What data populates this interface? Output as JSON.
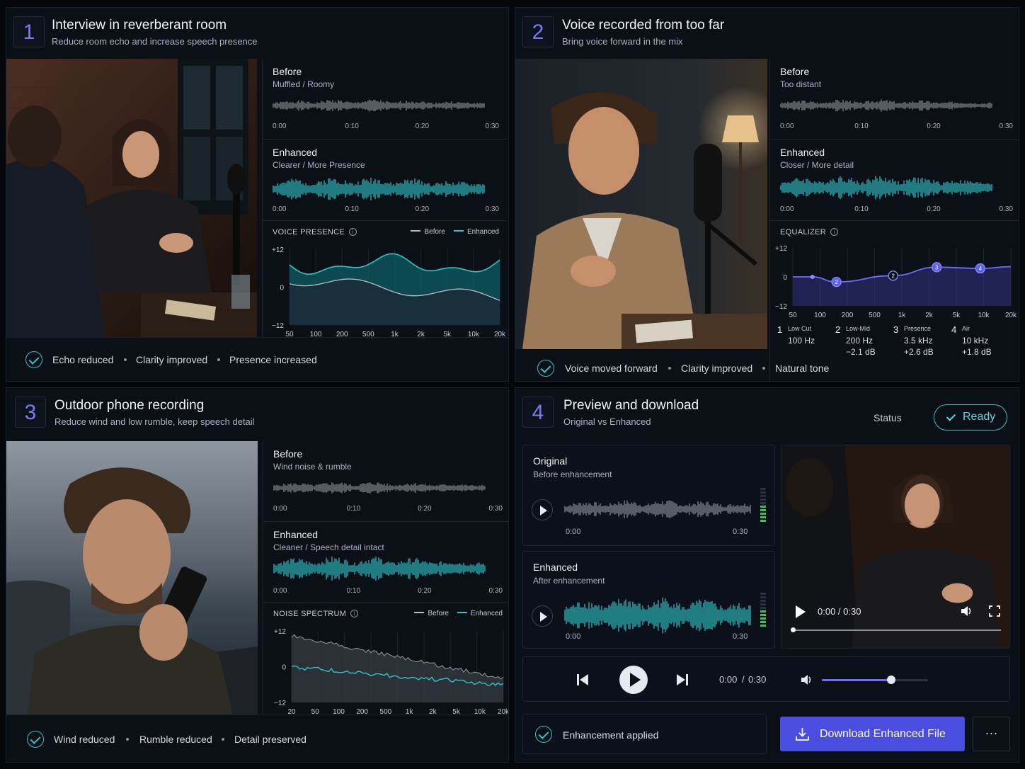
{
  "panels": [
    {
      "num": "1",
      "title": "Interview in reverberant room",
      "subtitle": "Reduce room echo and increase speech presence",
      "before": {
        "title": "Before",
        "subtitle": "Muffled / Roomy"
      },
      "enhanced": {
        "title": "Enhanced",
        "subtitle": "Clearer / More Presence"
      },
      "times": [
        "0:00",
        "0:10",
        "0:20",
        "0:30"
      ],
      "chart_label": "VOICE PRESENCE",
      "legend_before": "Before",
      "legend_enhanced": "Enhanced",
      "yticks": [
        "+12",
        "0",
        "−12"
      ],
      "xticks": [
        "50",
        "100",
        "200",
        "500",
        "1k",
        "2k",
        "5k",
        "10k",
        "20k"
      ],
      "footer": [
        "Echo reduced",
        "Clarity improved",
        "Presence increased"
      ]
    },
    {
      "num": "2",
      "title": "Voice recorded from too far",
      "subtitle": "Bring voice forward in the mix",
      "before": {
        "title": "Before",
        "subtitle": "Too distant"
      },
      "enhanced": {
        "title": "Enhanced",
        "subtitle": "Closer / More detail"
      },
      "times": [
        "0:00",
        "0:10",
        "0:20",
        "0:30"
      ],
      "chart_label": "EQUALIZER",
      "yticks": [
        "+12",
        "0",
        "−12"
      ],
      "xticks": [
        "50",
        "100",
        "200",
        "500",
        "1k",
        "2k",
        "5k",
        "10k",
        "20k"
      ],
      "bands": [
        {
          "n": "1",
          "name": "Low Cut",
          "freq": "100 Hz",
          "gain": ""
        },
        {
          "n": "2",
          "name": "Low-Mid",
          "freq": "200 Hz",
          "gain": "−2.1 dB"
        },
        {
          "n": "3",
          "name": "Presence",
          "freq": "3.5 kHz",
          "gain": "+2.6 dB"
        },
        {
          "n": "4",
          "name": "Air",
          "freq": "10 kHz",
          "gain": "+1.8 dB"
        }
      ],
      "footer": [
        "Voice moved forward",
        "Clarity improved",
        "Natural tone"
      ]
    },
    {
      "num": "3",
      "title": "Outdoor phone recording",
      "subtitle": "Reduce wind and low rumble, keep speech detail",
      "before": {
        "title": "Before",
        "subtitle": "Wind noise & rumble"
      },
      "enhanced": {
        "title": "Enhanced",
        "subtitle": "Cleaner / Speech detail intact"
      },
      "times": [
        "0:00",
        "0:10",
        "0:20",
        "0:30"
      ],
      "chart_label": "NOISE SPECTRUM",
      "legend_before": "Before",
      "legend_enhanced": "Enhanced",
      "yticks": [
        "+12",
        "0",
        "−12"
      ],
      "xticks": [
        "20",
        "50",
        "100",
        "200",
        "500",
        "1k",
        "2k",
        "5k",
        "10k",
        "20k"
      ],
      "footer": [
        "Wind reduced",
        "Rumble reduced",
        "Detail preserved"
      ]
    },
    {
      "num": "4",
      "title": "Preview and download",
      "subtitle": "Original vs Enhanced",
      "status_label": "Status",
      "status_value": "Ready",
      "original": {
        "title": "Original",
        "subtitle": "Before enhancement",
        "t0": "0:00",
        "t1": "0:30"
      },
      "enhanced": {
        "title": "Enhanced",
        "subtitle": "After enhancement",
        "t0": "0:00",
        "t1": "0:30"
      },
      "video_time": "0:00 / 0:30",
      "player_time": "0:00",
      "player_sep": "/",
      "player_total": "0:30",
      "volume": 0.65,
      "applied": "Enhancement applied",
      "download": "Download Enhanced File",
      "more": "···"
    }
  ],
  "colors": {
    "accent": "#2ec5c9",
    "indigo": "#5b5ff0",
    "before_wave": "#8a8f98"
  }
}
